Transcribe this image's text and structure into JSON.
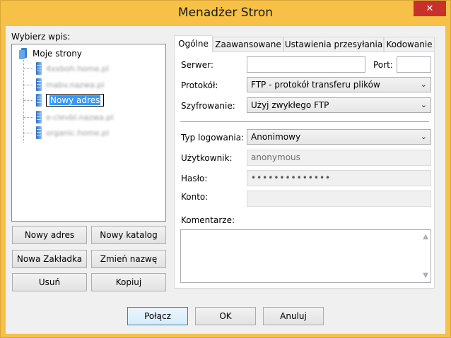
{
  "window": {
    "title": "Menadżer Stron",
    "close_glyph": "✕"
  },
  "left": {
    "select_label": "Wybierz wpis:",
    "tree_root": "Moje strony",
    "tree_items": [
      "4xxboh.home.pl",
      "mabv.nazwa.pl",
      "Nowy adres",
      "e-clevbl.nazwa.pl",
      "organic.home.pl"
    ],
    "editing_value": "Nowy adres"
  },
  "buttons": {
    "new_site": "Nowy adres",
    "new_folder": "Nowy katalog",
    "new_bookmark": "Nowa Zakładka",
    "rename": "Zmień nazwę",
    "delete": "Usuń",
    "copy": "Kopiuj",
    "connect": "Połącz",
    "ok": "OK",
    "cancel": "Anuluj"
  },
  "tabs": [
    "Ogólne",
    "Zaawansowane",
    "Ustawienia przesyłania",
    "Kodowanie"
  ],
  "general": {
    "server_label": "Serwer:",
    "server_value": "",
    "port_label": "Port:",
    "port_value": "",
    "protocol_label": "Protokół:",
    "protocol_value": "FTP - protokół transferu plików",
    "encryption_label": "Szyfrowanie:",
    "encryption_value": "Użyj zwykłego FTP",
    "logon_type_label": "Typ logowania:",
    "logon_type_value": "Anonimowy",
    "user_label": "Użytkownik:",
    "user_value": "anonymous",
    "password_label": "Hasło:",
    "password_value": "••••••••••••••",
    "account_label": "Konto:",
    "account_value": "",
    "comments_label": "Komentarze:"
  },
  "icons": {
    "chevron": "⌄",
    "scroll_up": "▲",
    "scroll_down": "▼"
  },
  "colors": {
    "title_bar": "#f6c146",
    "close_button": "#c7302b",
    "selection": "#3399ff"
  }
}
